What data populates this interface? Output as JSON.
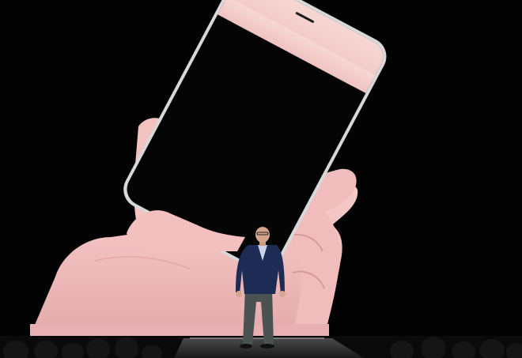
{
  "photo": {
    "subject": "keynote-stage-with-phone-on-screen",
    "colors": {
      "background": "#030303",
      "skin": "#f3c2c1",
      "skin_shadow": "#d99c9e",
      "phone_screen": "#050505",
      "phone_bezel": "#ececec",
      "phone_top": "#f6d4d2",
      "suit": "#1c2a52",
      "trousers": "#4a5050",
      "stage": "#b0b0b0"
    }
  }
}
